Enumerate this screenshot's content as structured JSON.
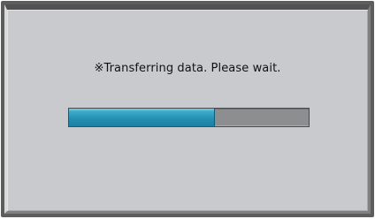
{
  "dialog": {
    "message": "※Transferring data. Please wait.",
    "progress": {
      "fraction": 0.61
    }
  },
  "colors": {
    "dialog_background": "#c9cacd",
    "frame": "#5d5d5d",
    "progress_fill": "#2690b4",
    "progress_track": "#8d8e90"
  }
}
